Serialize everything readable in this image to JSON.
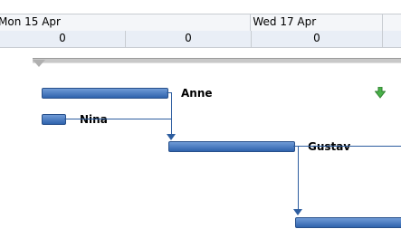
{
  "timescale": {
    "dates": [
      "Mon 15 Apr",
      "Wed 17 Apr"
    ],
    "counts": [
      "0",
      "0",
      "0"
    ]
  },
  "tasks": [
    {
      "label": "Anne"
    },
    {
      "label": "Nina"
    },
    {
      "label": "Gustav"
    }
  ],
  "colors": {
    "bar": "#3f73be",
    "link": "#2d5d9f",
    "indicator": "#3aa63a"
  },
  "icons": [
    "green-down-arrow-icon"
  ]
}
